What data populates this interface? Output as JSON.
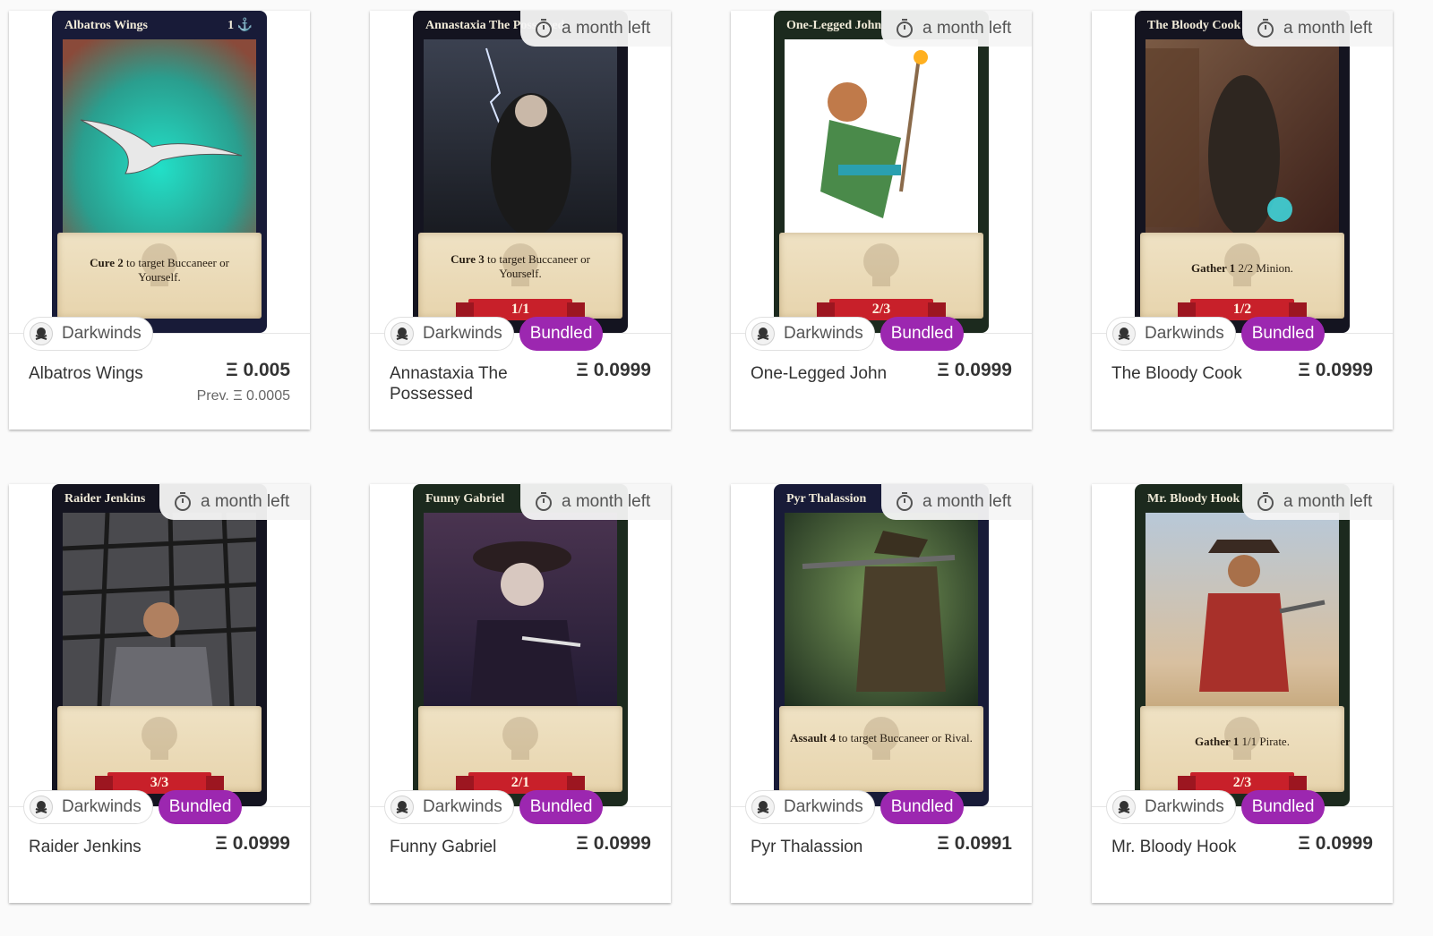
{
  "timer_text": "a month left",
  "collection_name": "Darkwinds",
  "bundle_label": "Bundled",
  "items": [
    {
      "card_name": "Albatros Wings",
      "card_cost": "1",
      "rules_keyword": "Cure 2",
      "rules_text": " to target Buccaneer or Yourself.",
      "stats": "",
      "title": "Albatros Wings",
      "price": "Ξ 0.005",
      "prev_price": "Prev. Ξ 0.0005",
      "has_timer": false,
      "bundled": false,
      "art_color": "#2fb9a8"
    },
    {
      "card_name": "Annastaxia The Possessed",
      "card_cost": "",
      "rules_keyword": "Cure 3",
      "rules_text": " to target Buccaneer or Yourself.",
      "stats": "1/1",
      "title": "Annastaxia The Possessed",
      "price": "Ξ 0.0999",
      "prev_price": "",
      "has_timer": true,
      "bundled": true,
      "art_color": "#2b2f38"
    },
    {
      "card_name": "One-Legged John",
      "card_cost": "",
      "rules_keyword": "",
      "rules_text": "",
      "stats": "2/3",
      "title": "One-Legged John",
      "price": "Ξ 0.0999",
      "prev_price": "",
      "has_timer": true,
      "bundled": true,
      "art_color": "#ffffff"
    },
    {
      "card_name": "The Bloody Cook",
      "card_cost": "",
      "rules_keyword": "Gather 1",
      "rules_text": " 2/2 Minion.",
      "stats": "1/2",
      "title": "The Bloody Cook",
      "price": "Ξ 0.0999",
      "prev_price": "",
      "has_timer": true,
      "bundled": true,
      "art_color": "#5a3a2e"
    },
    {
      "card_name": "Raider Jenkins",
      "card_cost": "",
      "rules_keyword": "",
      "rules_text": "",
      "stats": "3/3",
      "title": "Raider Jenkins",
      "price": "Ξ 0.0999",
      "prev_price": "",
      "has_timer": true,
      "bundled": true,
      "art_color": "#3a3a3c"
    },
    {
      "card_name": "Funny Gabriel",
      "card_cost": "",
      "rules_keyword": "",
      "rules_text": "",
      "stats": "2/1",
      "title": "Funny Gabriel",
      "price": "Ξ 0.0999",
      "prev_price": "",
      "has_timer": true,
      "bundled": true,
      "art_color": "#3a2a4a"
    },
    {
      "card_name": "Pyr Thalassion",
      "card_cost": "",
      "rules_keyword": "Assault 4",
      "rules_text": " to target Buccaneer or Rival.",
      "stats": "",
      "title": "Pyr Thalassion",
      "price": "Ξ 0.0991",
      "prev_price": "",
      "has_timer": true,
      "bundled": true,
      "art_color": "#3e5a3a"
    },
    {
      "card_name": "Mr. Bloody Hook",
      "card_cost": "",
      "rules_keyword": "Gather 1",
      "rules_text": " 1/1 Pirate.",
      "stats": "2/3",
      "title": "Mr. Bloody Hook",
      "price": "Ξ 0.0999",
      "prev_price": "",
      "has_timer": true,
      "bundled": true,
      "art_color": "#8a5a44"
    }
  ]
}
